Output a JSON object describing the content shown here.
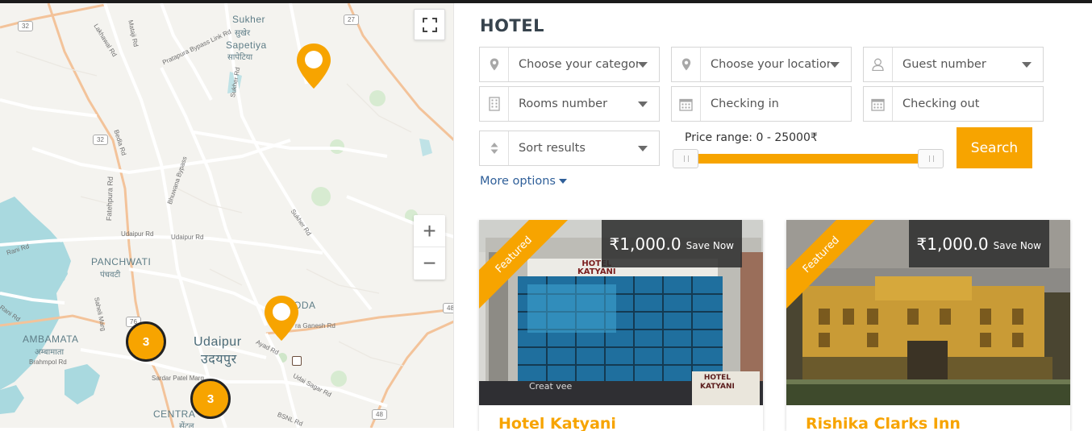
{
  "map": {
    "labels": {
      "sukher": "Sukher",
      "sukher_hi": "सुखेर",
      "sapetiya": "Sapetiya",
      "sapetiya_hi": "सापेटिया",
      "panchwati": "PANCHWATI",
      "panchwati_hi": "पंचवटी",
      "ambamata": "AMBAMATA",
      "ambamata_hi": "अम्बामाता",
      "udaipur": "Udaipur",
      "udaipur_hi": "उदयपुर",
      "centra": "CENTRA",
      "centra_hi": "सेंट्रल",
      "oda": "ODA",
      "lakhawal_rd": "Lakhawal Rd",
      "mataji_rd": "Mataji Rd",
      "pratapura_rd": "Pratapura Bypass Link Rd",
      "sukher_rd": "Sukher Rd",
      "sukher_rd2": "Sukher Rd",
      "bedla_rd": "Bedla Rd",
      "fatehpura_rd": "Fatehpura Rd",
      "bhuwana_bypass": "Bhuwana Bypass",
      "udaipur_rd": "Udaipur Rd",
      "udaipur_rd2": "Udaipur Rd",
      "rani_rd": "Rani Rd",
      "rani_rd2": "Rani Rd",
      "sahelimarg": "Saheli Marg",
      "brahmpol_rd": "Brahmpol Rd",
      "sardar_patel": "Sardar Patel Marg",
      "ganesh_rd": "ra Ganesh Rd",
      "ayad_rd": "Ayad Rd",
      "udai_sagar_rd": "Udai Sagar Rd",
      "bsnl_rd": "BSNL Rd",
      "shield_32a": "32",
      "shield_32b": "32",
      "shield_27": "27",
      "shield_76": "76",
      "shield_48": "48",
      "shield_48b": "48"
    },
    "clusters": [
      "3",
      "3"
    ],
    "zoom_in": "+",
    "zoom_out": "−"
  },
  "page": {
    "title": "HOTEL"
  },
  "filters": {
    "category": "Choose your category",
    "location": "Choose your location",
    "guests": "Guest number",
    "rooms": "Rooms number",
    "checkin": "Checking in",
    "checkout": "Checking out",
    "sort": "Sort results"
  },
  "price_range": {
    "label": "Price range: 0 - 25000₹",
    "min": 0,
    "max": 25000
  },
  "search_label": "Search",
  "more_options": "More options",
  "colors": {
    "accent": "#f7a400",
    "link": "#2f5f99",
    "title": "#37434d"
  },
  "listings": [
    {
      "badge": "Featured",
      "price": "₹1,000.0",
      "save": "Save Now",
      "name": "Hotel Katyani",
      "sign": "HOTEL\nKATYANI",
      "sign2": "HOTEL\nKATYANI",
      "shop": "Creat vee"
    },
    {
      "badge": "Featured",
      "price": "₹1,000.0",
      "save": "Save Now",
      "name": "Rishika Clarks Inn"
    }
  ]
}
